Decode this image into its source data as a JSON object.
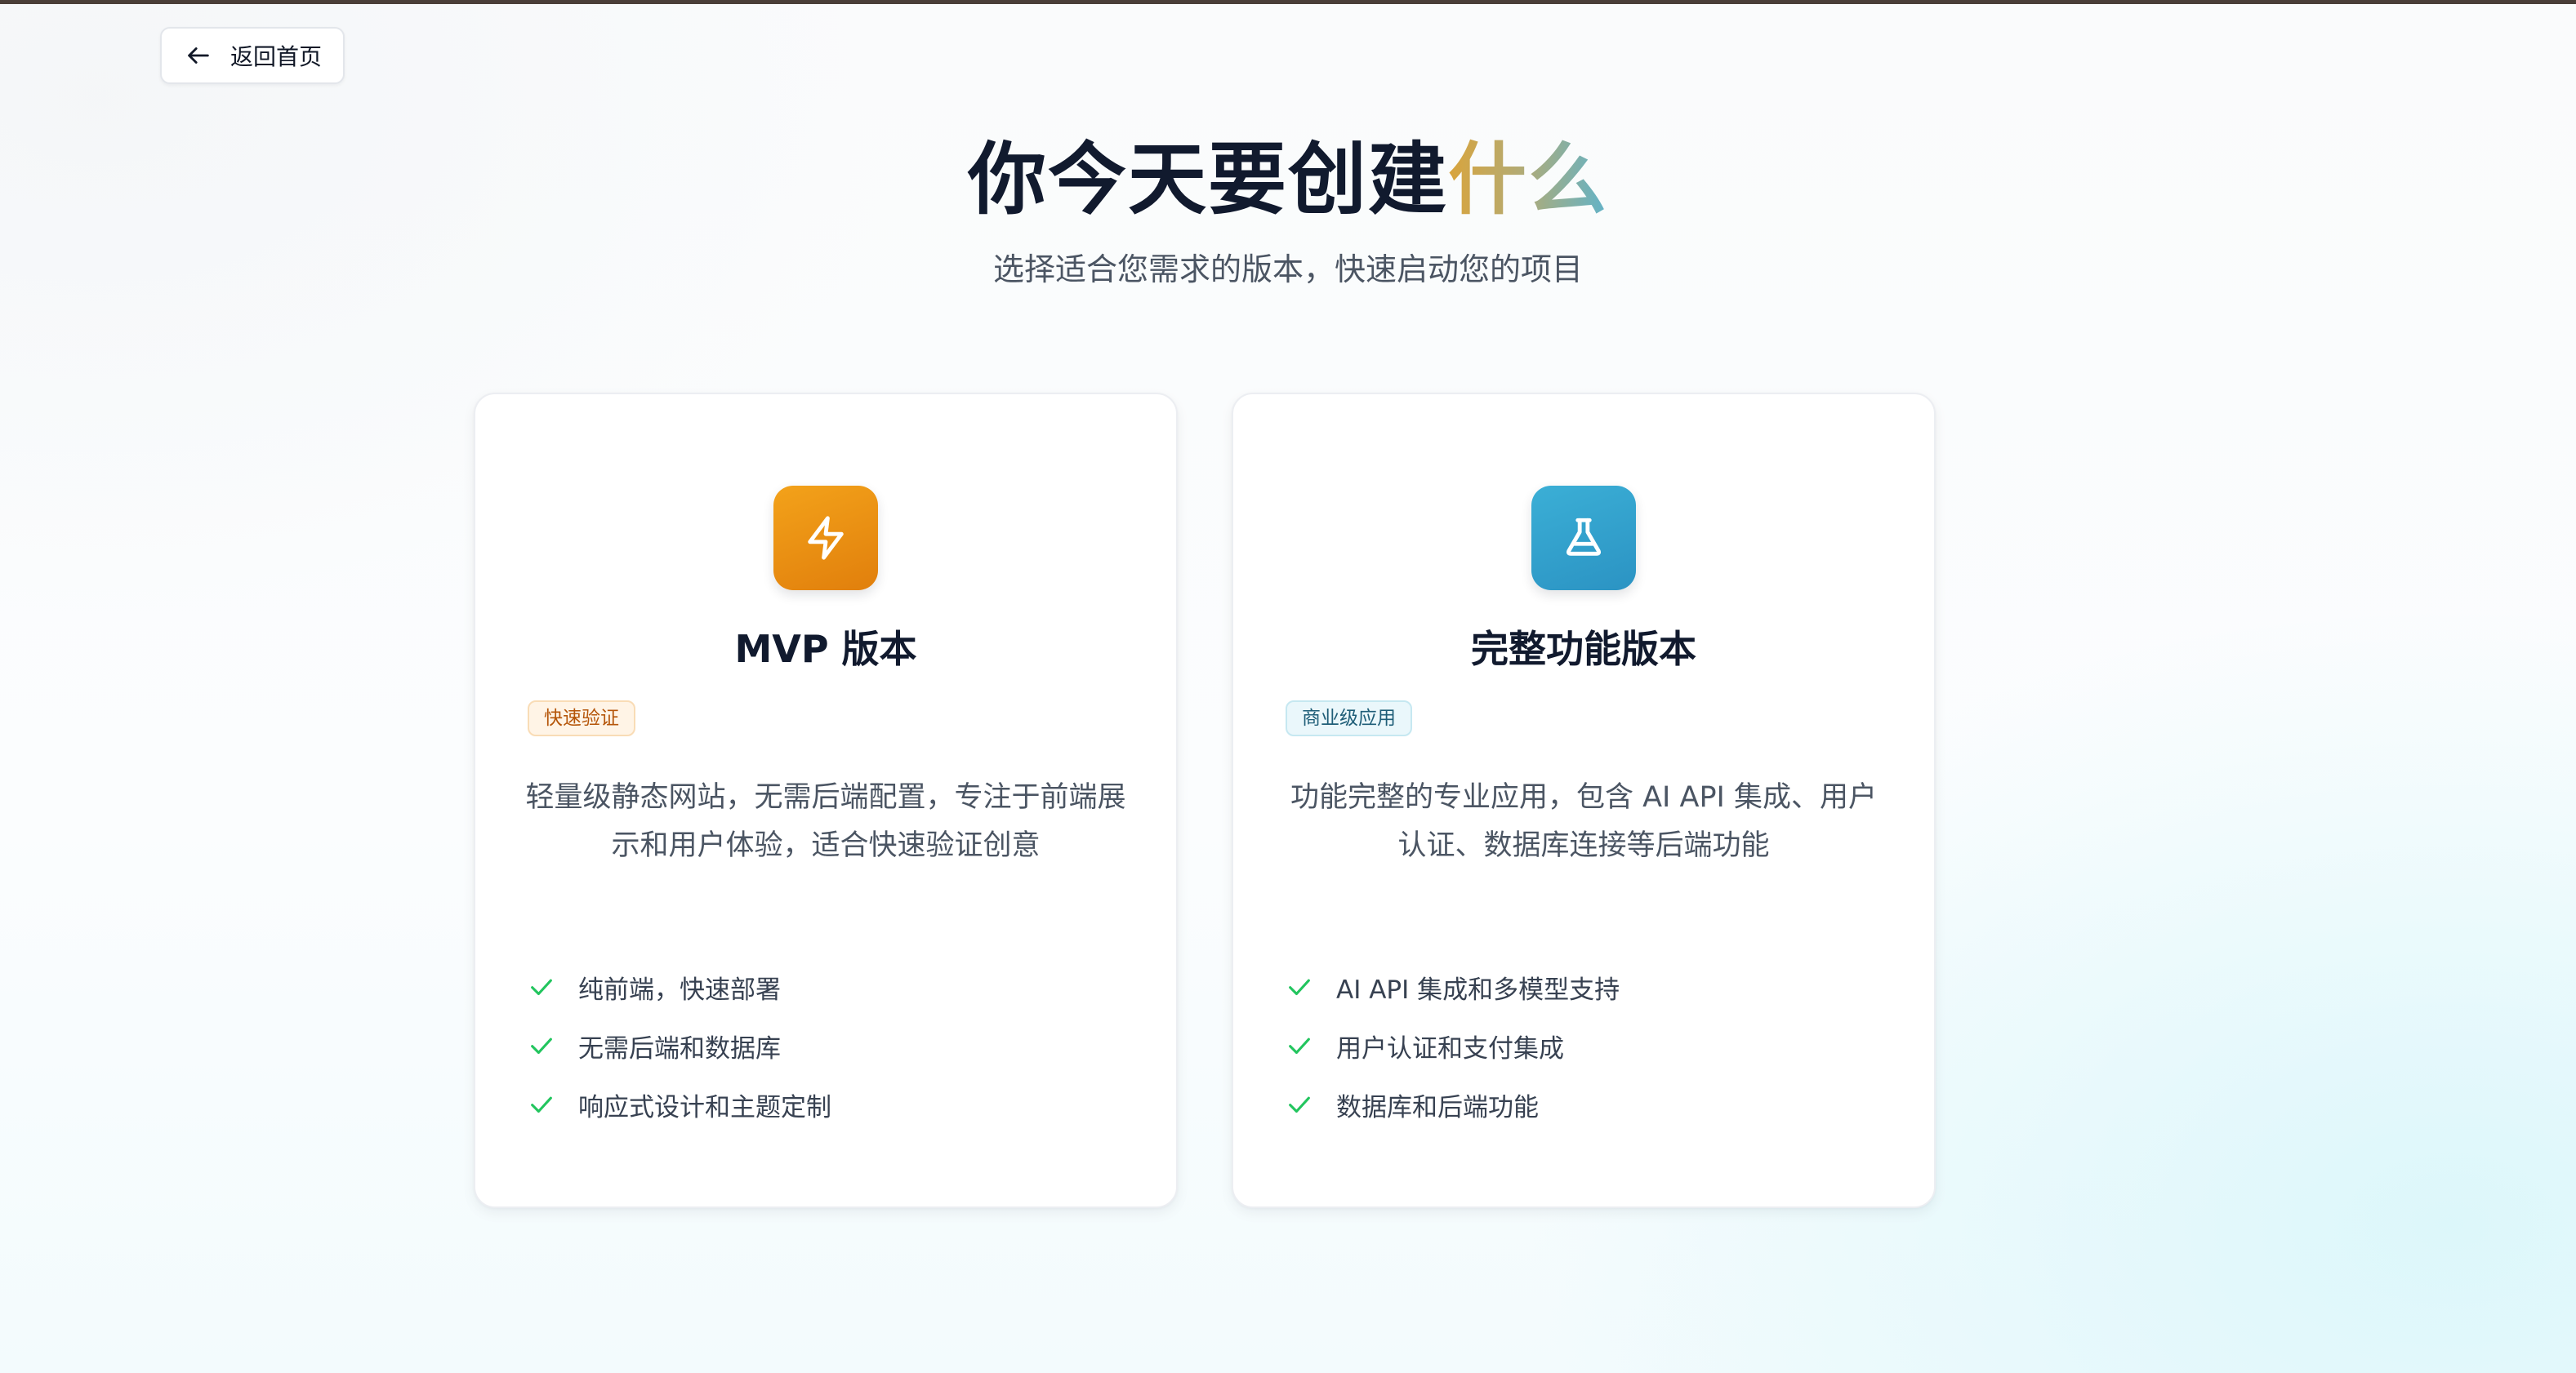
{
  "nav": {
    "back_icon": "arrow-left-icon",
    "back_label": "返回首页"
  },
  "hero": {
    "title_main": "你今天要创建",
    "title_accent": "什么",
    "subtitle": "选择适合您需求的版本，快速启动您的项目"
  },
  "colors": {
    "top_bar": "#4a3e38",
    "accent_gradient": [
      "#d9a43c",
      "#b3ab74",
      "#61b3c9"
    ],
    "mvp_icon": "#ee9312",
    "full_icon": "#34a3cd",
    "check": "#22c55e"
  },
  "plans": [
    {
      "icon": "lightning-bolt-icon",
      "title": "MVP 版本",
      "badge": "快速验证",
      "description": "轻量级静态网站，无需后端配置，专注于前端展示和用户体验，适合快速验证创意",
      "features": [
        "纯前端，快速部署",
        "无需后端和数据库",
        "响应式设计和主题定制"
      ]
    },
    {
      "icon": "flask-icon",
      "title": "完整功能版本",
      "badge": "商业级应用",
      "description": "功能完整的专业应用，包含 AI API 集成、用户认证、数据库连接等后端功能",
      "features": [
        "AI API 集成和多模型支持",
        "用户认证和支付集成",
        "数据库和后端功能"
      ]
    }
  ]
}
